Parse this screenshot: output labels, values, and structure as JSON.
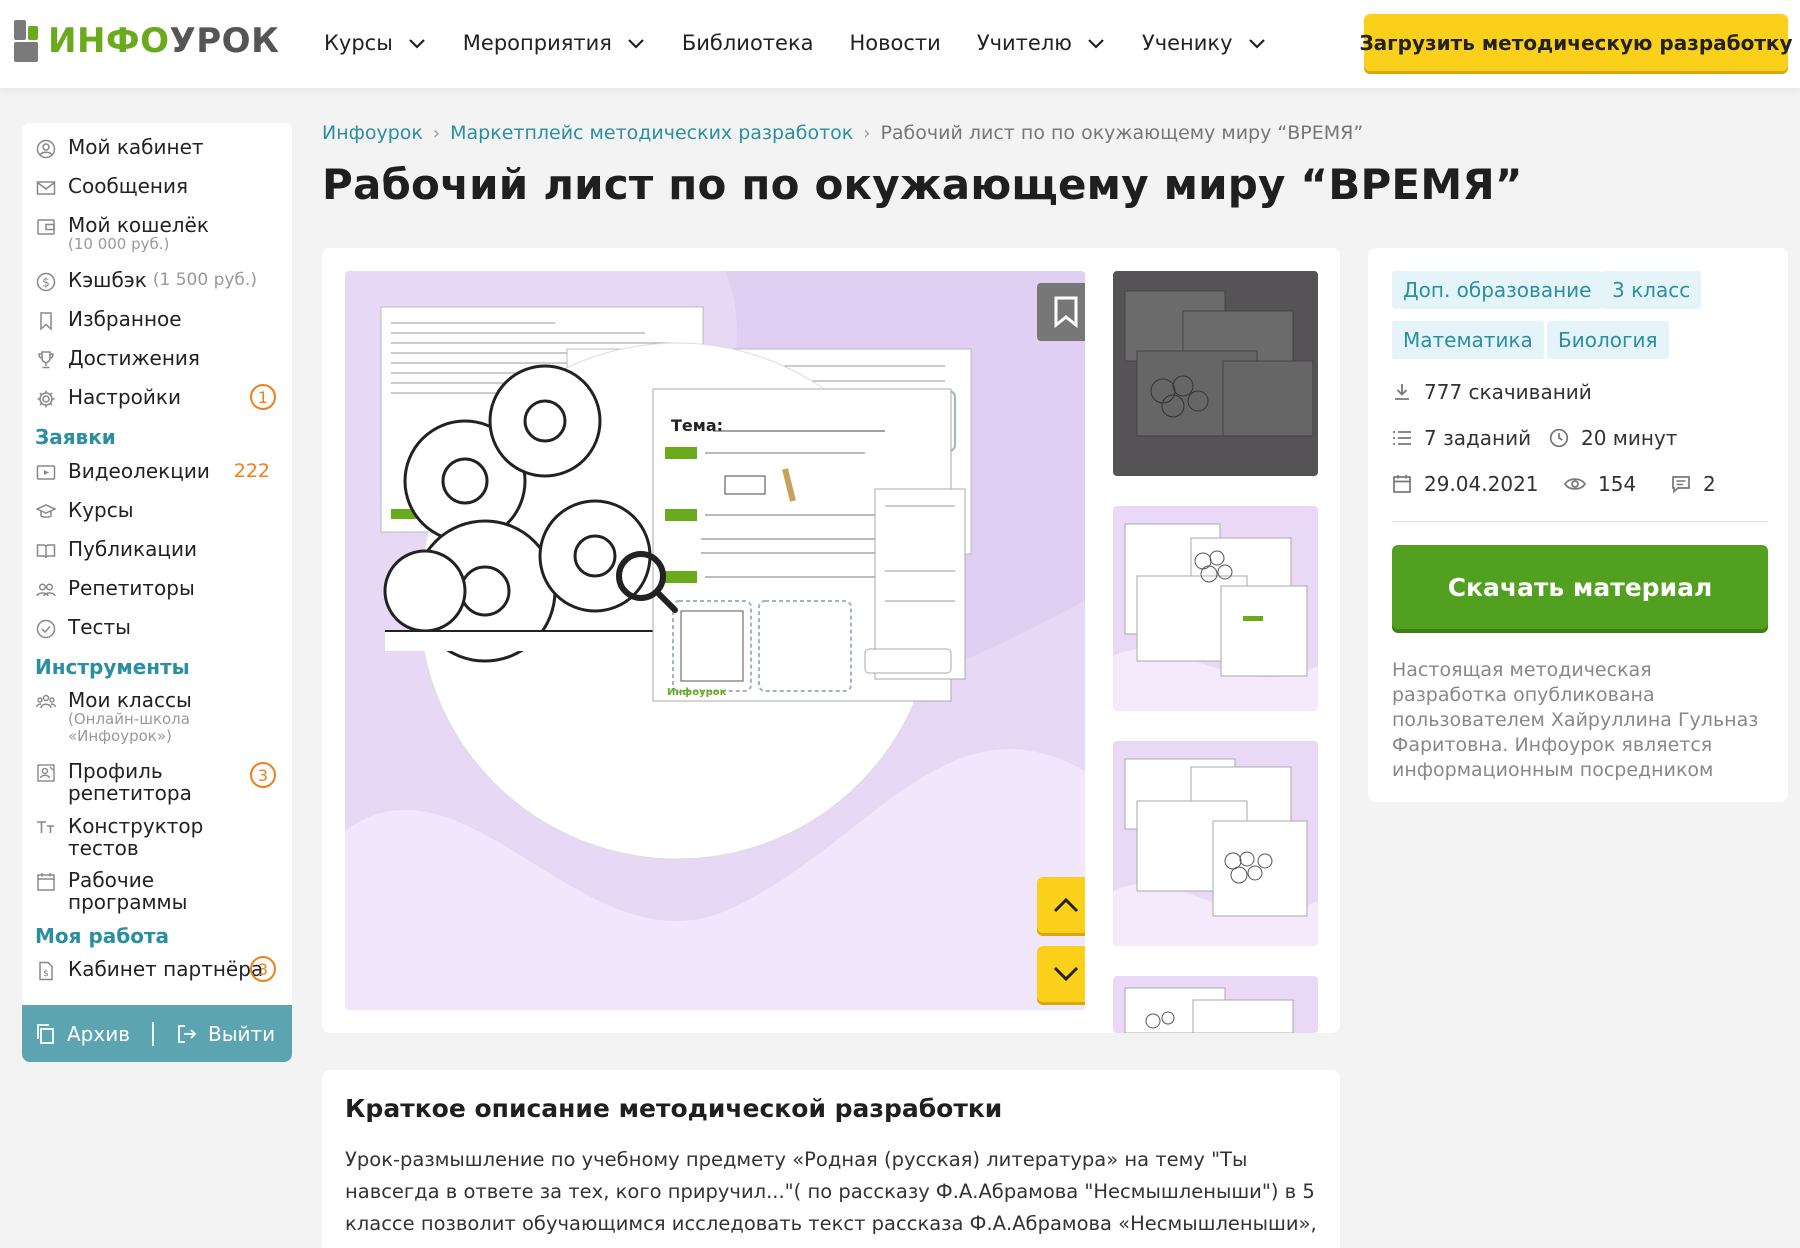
{
  "header": {
    "logo_text_1": "ИНФО",
    "logo_text_2": "УРОК",
    "nav": [
      {
        "label": "Курсы",
        "has_dropdown": true
      },
      {
        "label": "Мероприятия",
        "has_dropdown": true
      },
      {
        "label": "Библиотека",
        "has_dropdown": false
      },
      {
        "label": "Новости",
        "has_dropdown": false
      },
      {
        "label": "Учителю",
        "has_dropdown": true
      },
      {
        "label": "Ученику",
        "has_dropdown": true
      }
    ],
    "upload_button": "Загрузить методическую разработку"
  },
  "sidebar": {
    "items": [
      {
        "label": "Мой кабинет",
        "icon": "user-icon"
      },
      {
        "label": "Сообщения",
        "icon": "envelope-icon"
      },
      {
        "label": "Мой кошелёк",
        "sub": "(10 000 руб.)",
        "icon": "wallet-icon"
      },
      {
        "label": "Кэшбэк",
        "inline_sub": "(1 500 руб.)",
        "icon": "dollar-icon"
      },
      {
        "label": "Избранное",
        "icon": "bookmark-icon"
      },
      {
        "label": "Достижения",
        "icon": "trophy-icon"
      },
      {
        "label": "Настройки",
        "badge": "1",
        "icon": "gear-icon"
      }
    ],
    "section_requests": "Заявки",
    "requests": [
      {
        "label": "Видеолекции",
        "count": "222",
        "icon": "video-icon"
      },
      {
        "label": "Курсы",
        "icon": "graduation-cap-icon"
      },
      {
        "label": "Публикации",
        "icon": "book-icon"
      },
      {
        "label": "Репетиторы",
        "icon": "people-icon"
      },
      {
        "label": "Тесты",
        "icon": "check-circle-icon"
      }
    ],
    "section_tools": "Инструменты",
    "tools": [
      {
        "label": "Мои классы",
        "sub": "(Онлайн-школа «Инфоурок»)",
        "icon": "class-icon"
      },
      {
        "label": "Профиль репетитора",
        "badge": "3",
        "icon": "tutor-profile-icon"
      },
      {
        "label": "Конструктор тестов",
        "icon": "text-constructor-icon"
      },
      {
        "label": "Рабочие программы",
        "icon": "calendar-icon"
      }
    ],
    "section_work": "Моя работа",
    "work": [
      {
        "label": "Кабинет партнёра",
        "badge": "3",
        "icon": "document-dollar-icon"
      }
    ],
    "footer": {
      "archive": "Архив",
      "logout": "Выйти"
    }
  },
  "breadcrumb": {
    "home": "Инфоурок",
    "market": "Маркетплейс методических разработок",
    "current": "Рабочий лист по по окужающему миру “ВРЕМЯ”"
  },
  "page_title": "Рабочий лист по по окужающему миру “ВРЕМЯ”",
  "preview": {
    "worksheet_topic_label": "Тема:",
    "worksheet_logo": "Инфоурок"
  },
  "info": {
    "tags": [
      "Доп. образование",
      "3 класс",
      "Математика",
      "Биология"
    ],
    "downloads": "777 скачиваний",
    "tasks": "7 заданий",
    "duration": "20 минут",
    "date": "29.04.2021",
    "views": "154",
    "comments": "2",
    "download_button": "Скачать материал",
    "note": "Настоящая методическая разработка опубликована пользователем Хайруллина Гульназ Фаритовна. Инфоурок является информационным посредником"
  },
  "description": {
    "title": "Краткое описание методической разработки",
    "text": "Урок-размышление по учебному предмету «Родная (русская) литература» на тему \"Ты навсегда в ответе за тех, кого приручил...\"( по рассказу Ф.А.Абрамова \"Несмышленыши\") в 5 классе позволит обучающимся исследовать текст рассказа Ф.А.Абрамова «Несмышленыши», выявить"
  },
  "colors": {
    "brand_green": "#6aab1e",
    "accent_teal": "#2a8fa0",
    "yellow": "#fbd01b",
    "download_green": "#52a01f",
    "badge_orange": "#f07e1a"
  }
}
